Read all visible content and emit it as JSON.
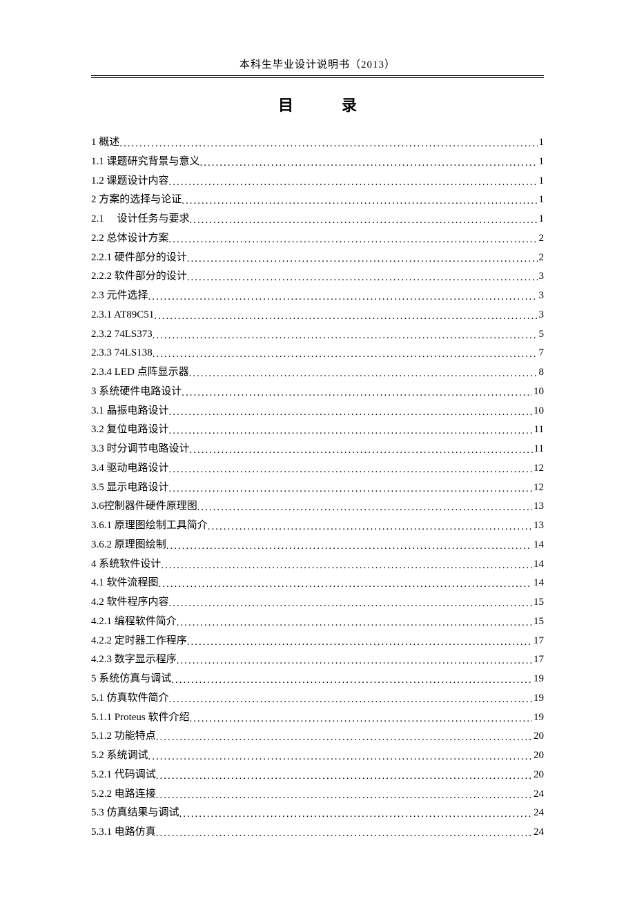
{
  "header": "本科生毕业设计说明书（2013）",
  "title": "目　录",
  "toc": [
    {
      "level": 1,
      "num": "1",
      "text": "概述",
      "page": "1"
    },
    {
      "level": 2,
      "num": "1.1",
      "text": "课题研究背景与意义",
      "page": "1"
    },
    {
      "level": 2,
      "num": "1.2",
      "text": "课题设计内容",
      "page": "1"
    },
    {
      "level": 1,
      "num": "2",
      "text": "方案的选择与论证",
      "page": "1"
    },
    {
      "level": 2,
      "num": "2.1",
      "text": "　设计任务与要求",
      "page": "1"
    },
    {
      "level": 2,
      "num": "2.2",
      "text": "总体设计方案",
      "page": "2"
    },
    {
      "level": 3,
      "num": "2.2.1",
      "text": "硬件部分的设计",
      "page": "2"
    },
    {
      "level": 3,
      "num": "2.2.2",
      "text": "软件部分的设计",
      "page": "3"
    },
    {
      "level": 2,
      "num": "2.3",
      "text": "元件选择",
      "page": "3"
    },
    {
      "level": 3,
      "num": "2.3.1",
      "text": "AT89C51",
      "page": "3"
    },
    {
      "level": 3,
      "num": "2.3.2",
      "text": "74LS373",
      "page": "5"
    },
    {
      "level": 3,
      "num": "2.3.3",
      "text": "74LS138",
      "page": "7"
    },
    {
      "level": 3,
      "num": "2.3.4",
      "text": "LED 点阵显示器 ",
      "page": "8"
    },
    {
      "level": 1,
      "num": "3",
      "text": "系统硬件电路设计",
      "page": "10"
    },
    {
      "level": 2,
      "num": "3.1",
      "text": "晶振电路设计",
      "page": "10"
    },
    {
      "level": 2,
      "num": "3.2",
      "text": "复位电路设计 ",
      "page": "11"
    },
    {
      "level": 2,
      "num": "3.3",
      "text": "时分调节电路设计",
      "page": "11"
    },
    {
      "level": 2,
      "num": "3.4",
      "text": "驱动电路设计",
      "page": "12"
    },
    {
      "level": 2,
      "num": "3.5",
      "text": "显示电路设计",
      "page": "12"
    },
    {
      "level": 2,
      "num": "3.6",
      "text": "控制器件硬件原理图 ",
      "page": "13",
      "nospace": true
    },
    {
      "level": 3,
      "num": "3.6.1",
      "text": "原理图绘制工具简介",
      "page": "13"
    },
    {
      "level": 3,
      "num": "3.6.2",
      "text": "原理图绘制",
      "page": "14"
    },
    {
      "level": 1,
      "num": "4",
      "text": "系统软件设计",
      "page": "14"
    },
    {
      "level": 2,
      "num": "4.1",
      "text": "软件流程图",
      "page": "14"
    },
    {
      "level": 2,
      "num": "4.2",
      "text": "软件程序内容",
      "page": "15"
    },
    {
      "level": 3,
      "num": "4.2.1",
      "text": "编程软件简介",
      "page": "15"
    },
    {
      "level": 3,
      "num": "4.2.2",
      "text": "定时器工作程序",
      "page": "17"
    },
    {
      "level": 3,
      "num": "4.2.3",
      "text": "数字显示程序",
      "page": "17"
    },
    {
      "level": 1,
      "num": "5",
      "text": "系统仿真与调试",
      "page": "19"
    },
    {
      "level": 2,
      "num": "5.1",
      "text": "仿真软件简介",
      "page": "19"
    },
    {
      "level": 3,
      "num": "5.1.1",
      "text": "Proteus 软件介绍 ",
      "page": "19"
    },
    {
      "level": 3,
      "num": "5.1.2",
      "text": "功能特点",
      "page": "20"
    },
    {
      "level": 2,
      "num": "5.2",
      "text": "系统调试",
      "page": "20"
    },
    {
      "level": 3,
      "num": "5.2.1",
      "text": "代码调试",
      "page": "20"
    },
    {
      "level": 3,
      "num": "5.2.2",
      "text": "电路连接",
      "page": "24"
    },
    {
      "level": 2,
      "num": "5.3",
      "text": "仿真结果与调试",
      "page": "24"
    },
    {
      "level": 3,
      "num": "5.3.1",
      "text": "电路仿真",
      "page": "24"
    }
  ]
}
